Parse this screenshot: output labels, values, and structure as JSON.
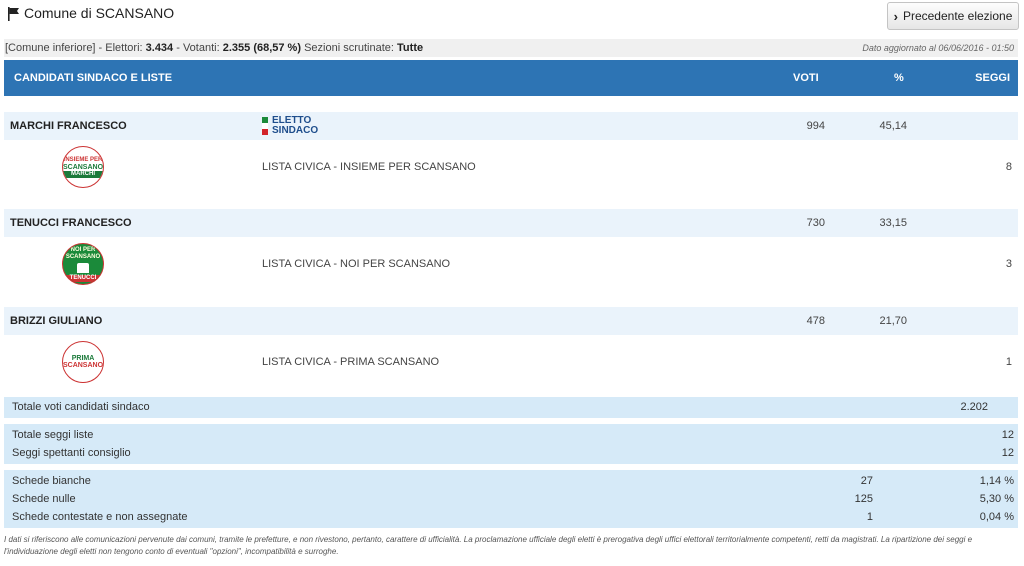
{
  "header": {
    "title": "Comune di SCANSANO",
    "prev_button": "Precedente elezione"
  },
  "info": {
    "type": "[Comune inferiore]",
    "electors_label": "Elettori:",
    "electors": "3.434",
    "voters_label": "Votanti:",
    "voters": "2.355",
    "turnout": "(68,57 %)",
    "sections_label": "Sezioni scrutinate:",
    "sections": "Tutte",
    "updated": "Dato aggiornato al 06/06/2016 - 01:50"
  },
  "table_head": {
    "candidates": "CANDIDATI SINDACO E LISTE",
    "votes": "VOTI",
    "pct": "%",
    "seats": "SEGGI"
  },
  "candidates": [
    {
      "name": "MARCHI FRANCESCO",
      "votes": "994",
      "pct": "45,14",
      "elected_line1": "ELETTO",
      "elected_line2": "SINDACO",
      "list": "LISTA CIVICA - INSIEME PER SCANSANO",
      "seats": "8",
      "logo_top": "INSIEME PER",
      "logo_mid": "SCANSANO",
      "logo_bottom": "MARCHI"
    },
    {
      "name": "TENUCCI FRANCESCO",
      "votes": "730",
      "pct": "33,15",
      "list": "LISTA CIVICA - NOI PER SCANSANO",
      "seats": "3",
      "logo_top": "NOI PER SCANSANO",
      "logo_bottom": "TENUCCI"
    },
    {
      "name": "BRIZZI GIULIANO",
      "votes": "478",
      "pct": "21,70",
      "list": "LISTA CIVICA - PRIMA SCANSANO",
      "seats": "1",
      "logo_top": "PRIMA",
      "logo_bottom": "SCANSANO"
    }
  ],
  "totals": {
    "candidate_votes_label": "Totale voti candidati sindaco",
    "candidate_votes": "2.202",
    "list_seats_label": "Totale seggi liste",
    "list_seats": "12",
    "council_seats_label": "Seggi spettanti consiglio",
    "council_seats": "12"
  },
  "ballots": [
    {
      "label": "Schede bianche",
      "count": "27",
      "pct": "1,14 %"
    },
    {
      "label": "Schede nulle",
      "count": "125",
      "pct": "5,30 %"
    },
    {
      "label": "Schede contestate e non assegnate",
      "count": "1",
      "pct": "0,04 %"
    }
  ],
  "footnote": "I dati si riferiscono alle comunicazioni pervenute dai comuni, tramite le prefetture, e non rivestono, pertanto, carattere di ufficialità. La proclamazione ufficiale degli eletti è prerogativa degli uffici elettorali territorialmente competenti, retti da magistrati. La ripartizione dei seggi e l'individuazione degli eletti non tengono conto di eventuali \"opzioni\", incompatibilità e surroghe.",
  "colors": {
    "header_bg": "#2d74b4",
    "row_bg": "#eaf3fb",
    "summary_bg": "#d6eaf8"
  }
}
